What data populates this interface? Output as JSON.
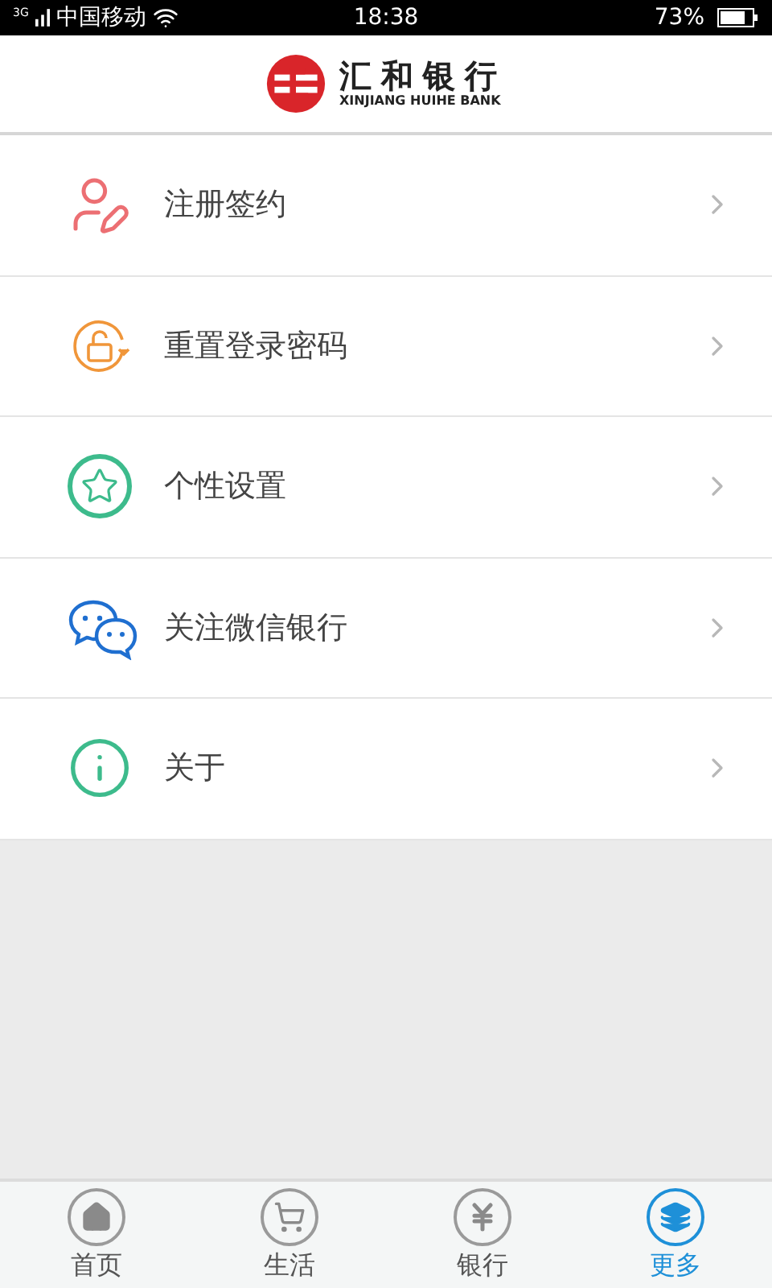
{
  "status_bar": {
    "network": "3G",
    "carrier": "中国移动",
    "time": "18:38",
    "battery": "73%"
  },
  "header": {
    "logo_name": "汇和银行",
    "logo_subtitle": "XINJIANG HUIHE BANK"
  },
  "menu": [
    {
      "kind": "register",
      "color": "#ec6f73",
      "label": "注册签约"
    },
    {
      "kind": "reset",
      "color": "#f0963a",
      "label": "重置登录密码"
    },
    {
      "kind": "personalize",
      "color": "#3dbb8c",
      "label": "个性设置"
    },
    {
      "kind": "wechat",
      "color": "#1f6fd0",
      "label": "关注微信银行"
    },
    {
      "kind": "about",
      "color": "#3dbb8c",
      "label": "关于"
    }
  ],
  "tab_bar": [
    {
      "kind": "home",
      "label": "首页",
      "selected": false
    },
    {
      "kind": "life",
      "label": "生活",
      "selected": false
    },
    {
      "kind": "bank",
      "label": "银行",
      "selected": false
    },
    {
      "kind": "more",
      "label": "更多",
      "selected": true
    }
  ]
}
